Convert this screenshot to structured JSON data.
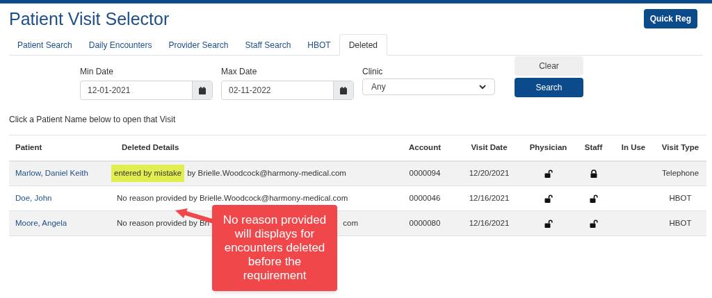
{
  "title": "Patient Visit Selector",
  "quick_reg_button": "Quick Reg",
  "tabs": [
    {
      "label": "Patient Search",
      "selected": false
    },
    {
      "label": "Daily Encounters",
      "selected": false
    },
    {
      "label": "Provider Search",
      "selected": false
    },
    {
      "label": "Staff Search",
      "selected": false
    },
    {
      "label": "HBOT",
      "selected": false
    },
    {
      "label": "Deleted",
      "selected": true
    }
  ],
  "filters": {
    "min_date": {
      "label": "Min Date",
      "value": "12-01-2021"
    },
    "max_date": {
      "label": "Max Date",
      "value": "02-11-2022"
    },
    "clinic": {
      "label": "Clinic",
      "value": "Any"
    },
    "clear_button": "Clear",
    "search_button": "Search"
  },
  "instruction": "Click a Patient Name below to open that Visit",
  "table": {
    "columns": [
      "Patient",
      "Deleted Details",
      "Account",
      "Visit Date",
      "Physician",
      "Staff",
      "In Use",
      "Visit Type"
    ],
    "rows": [
      {
        "patient": "Marlow, Daniel Keith",
        "details": [
          {
            "text": "entered by mistake",
            "highlighted": true
          },
          {
            "text": "by Brielle.Woodcock@harmony-medical.com",
            "highlighted": false
          }
        ],
        "details_covered": false,
        "account": "0000094",
        "visit_date": "12/20/2021",
        "physician_locked": false,
        "staff_locked": true,
        "visit_type": "Telephone"
      },
      {
        "patient": "Doe, John",
        "details": [
          {
            "text": "No reason provided by Brielle.Woodcock@harmony-medical.com",
            "highlighted": false
          }
        ],
        "details_covered": false,
        "account": "0000046",
        "visit_date": "12/16/2021",
        "physician_locked": false,
        "staff_locked": false,
        "visit_type": "HBOT"
      },
      {
        "patient": "Moore, Angela",
        "details": [
          {
            "text": "No reason provided by Bri",
            "highlighted": false
          },
          {
            "text": "com",
            "highlighted": false
          }
        ],
        "details_covered": true,
        "account": "0000080",
        "visit_date": "12/16/2021",
        "physician_locked": false,
        "staff_locked": false,
        "visit_type": "HBOT"
      }
    ]
  },
  "callout": {
    "text": "No reason provided will displays for encounters deleted before the requirement"
  }
}
